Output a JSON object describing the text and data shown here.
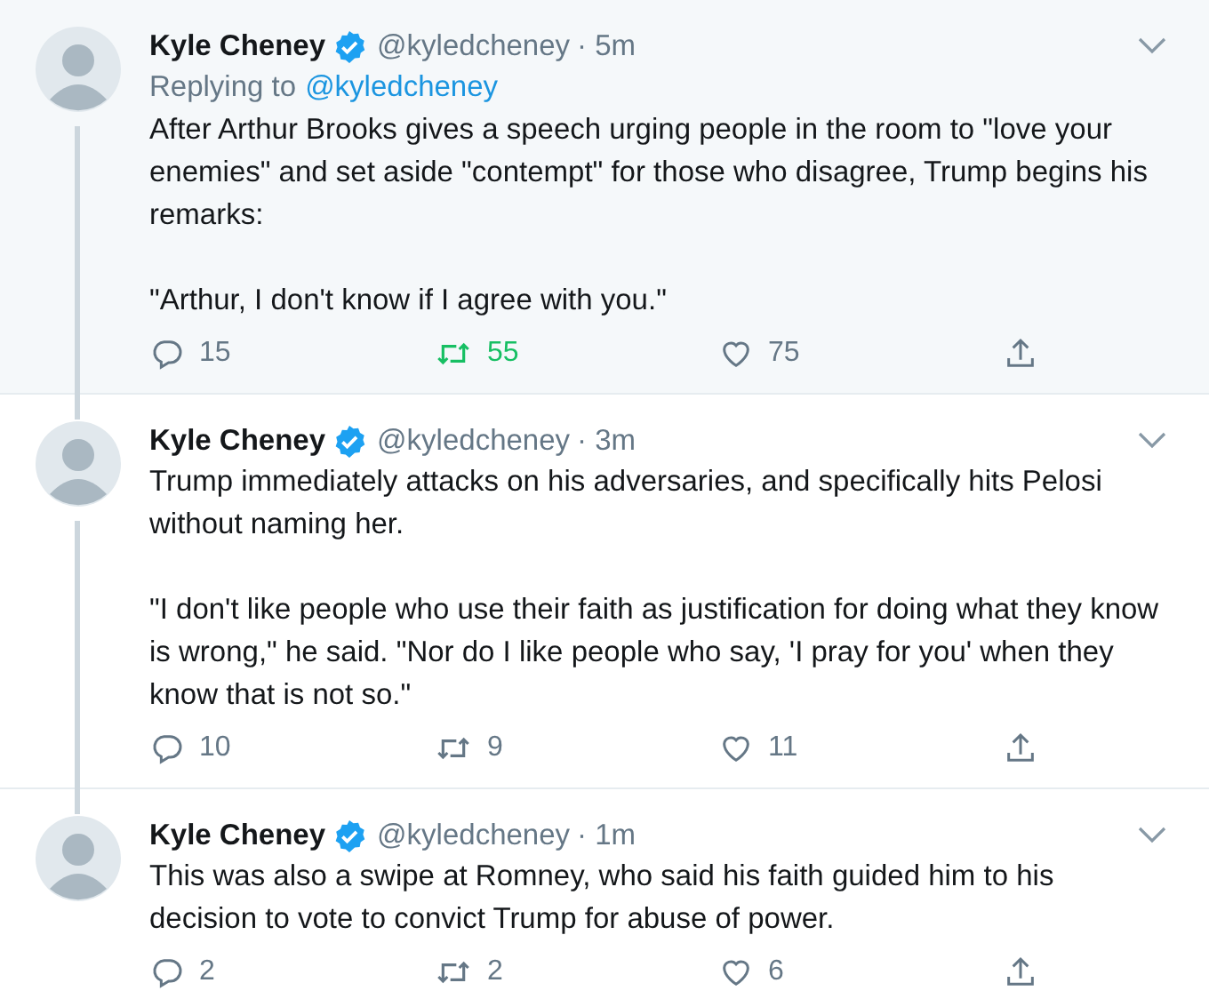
{
  "tweets": [
    {
      "name": "Kyle Cheney",
      "verified": true,
      "handle": "@kyledcheney",
      "time": "· 5m",
      "replying_label": "Replying to",
      "replying_to": "@kyledcheney",
      "highlighted": true,
      "thread_continues": true,
      "paragraphs": [
        "After Arthur Brooks gives a speech urging people in the room to \"love your enemies\" and set aside \"contempt\" for those who disagree, Trump begins his remarks:",
        "\"Arthur, I don't know if I agree with you.\""
      ],
      "replies": "15",
      "retweets": "55",
      "retweeted": true,
      "likes": "75",
      "liked": false
    },
    {
      "name": "Kyle Cheney",
      "verified": true,
      "handle": "@kyledcheney",
      "time": "· 3m",
      "highlighted": false,
      "thread_continues": true,
      "paragraphs": [
        "Trump immediately attacks on his adversaries, and specifically hits Pelosi without naming her.",
        "\"I don't like people who use their faith as justification for doing what they know is wrong,\" he said. \"Nor do I like people who say, 'I pray for you' when they know that is not so.\""
      ],
      "replies": "10",
      "retweets": "9",
      "retweeted": false,
      "likes": "11",
      "liked": false
    },
    {
      "name": "Kyle Cheney",
      "verified": true,
      "handle": "@kyledcheney",
      "time": "· 1m",
      "highlighted": false,
      "thread_continues": false,
      "paragraphs": [
        "This was also a swipe at Romney, who said his faith guided him to his decision to vote to convict Trump for abuse of power."
      ],
      "replies": "2",
      "retweets": "2",
      "retweeted": false,
      "likes": "6",
      "liked": false
    }
  ]
}
